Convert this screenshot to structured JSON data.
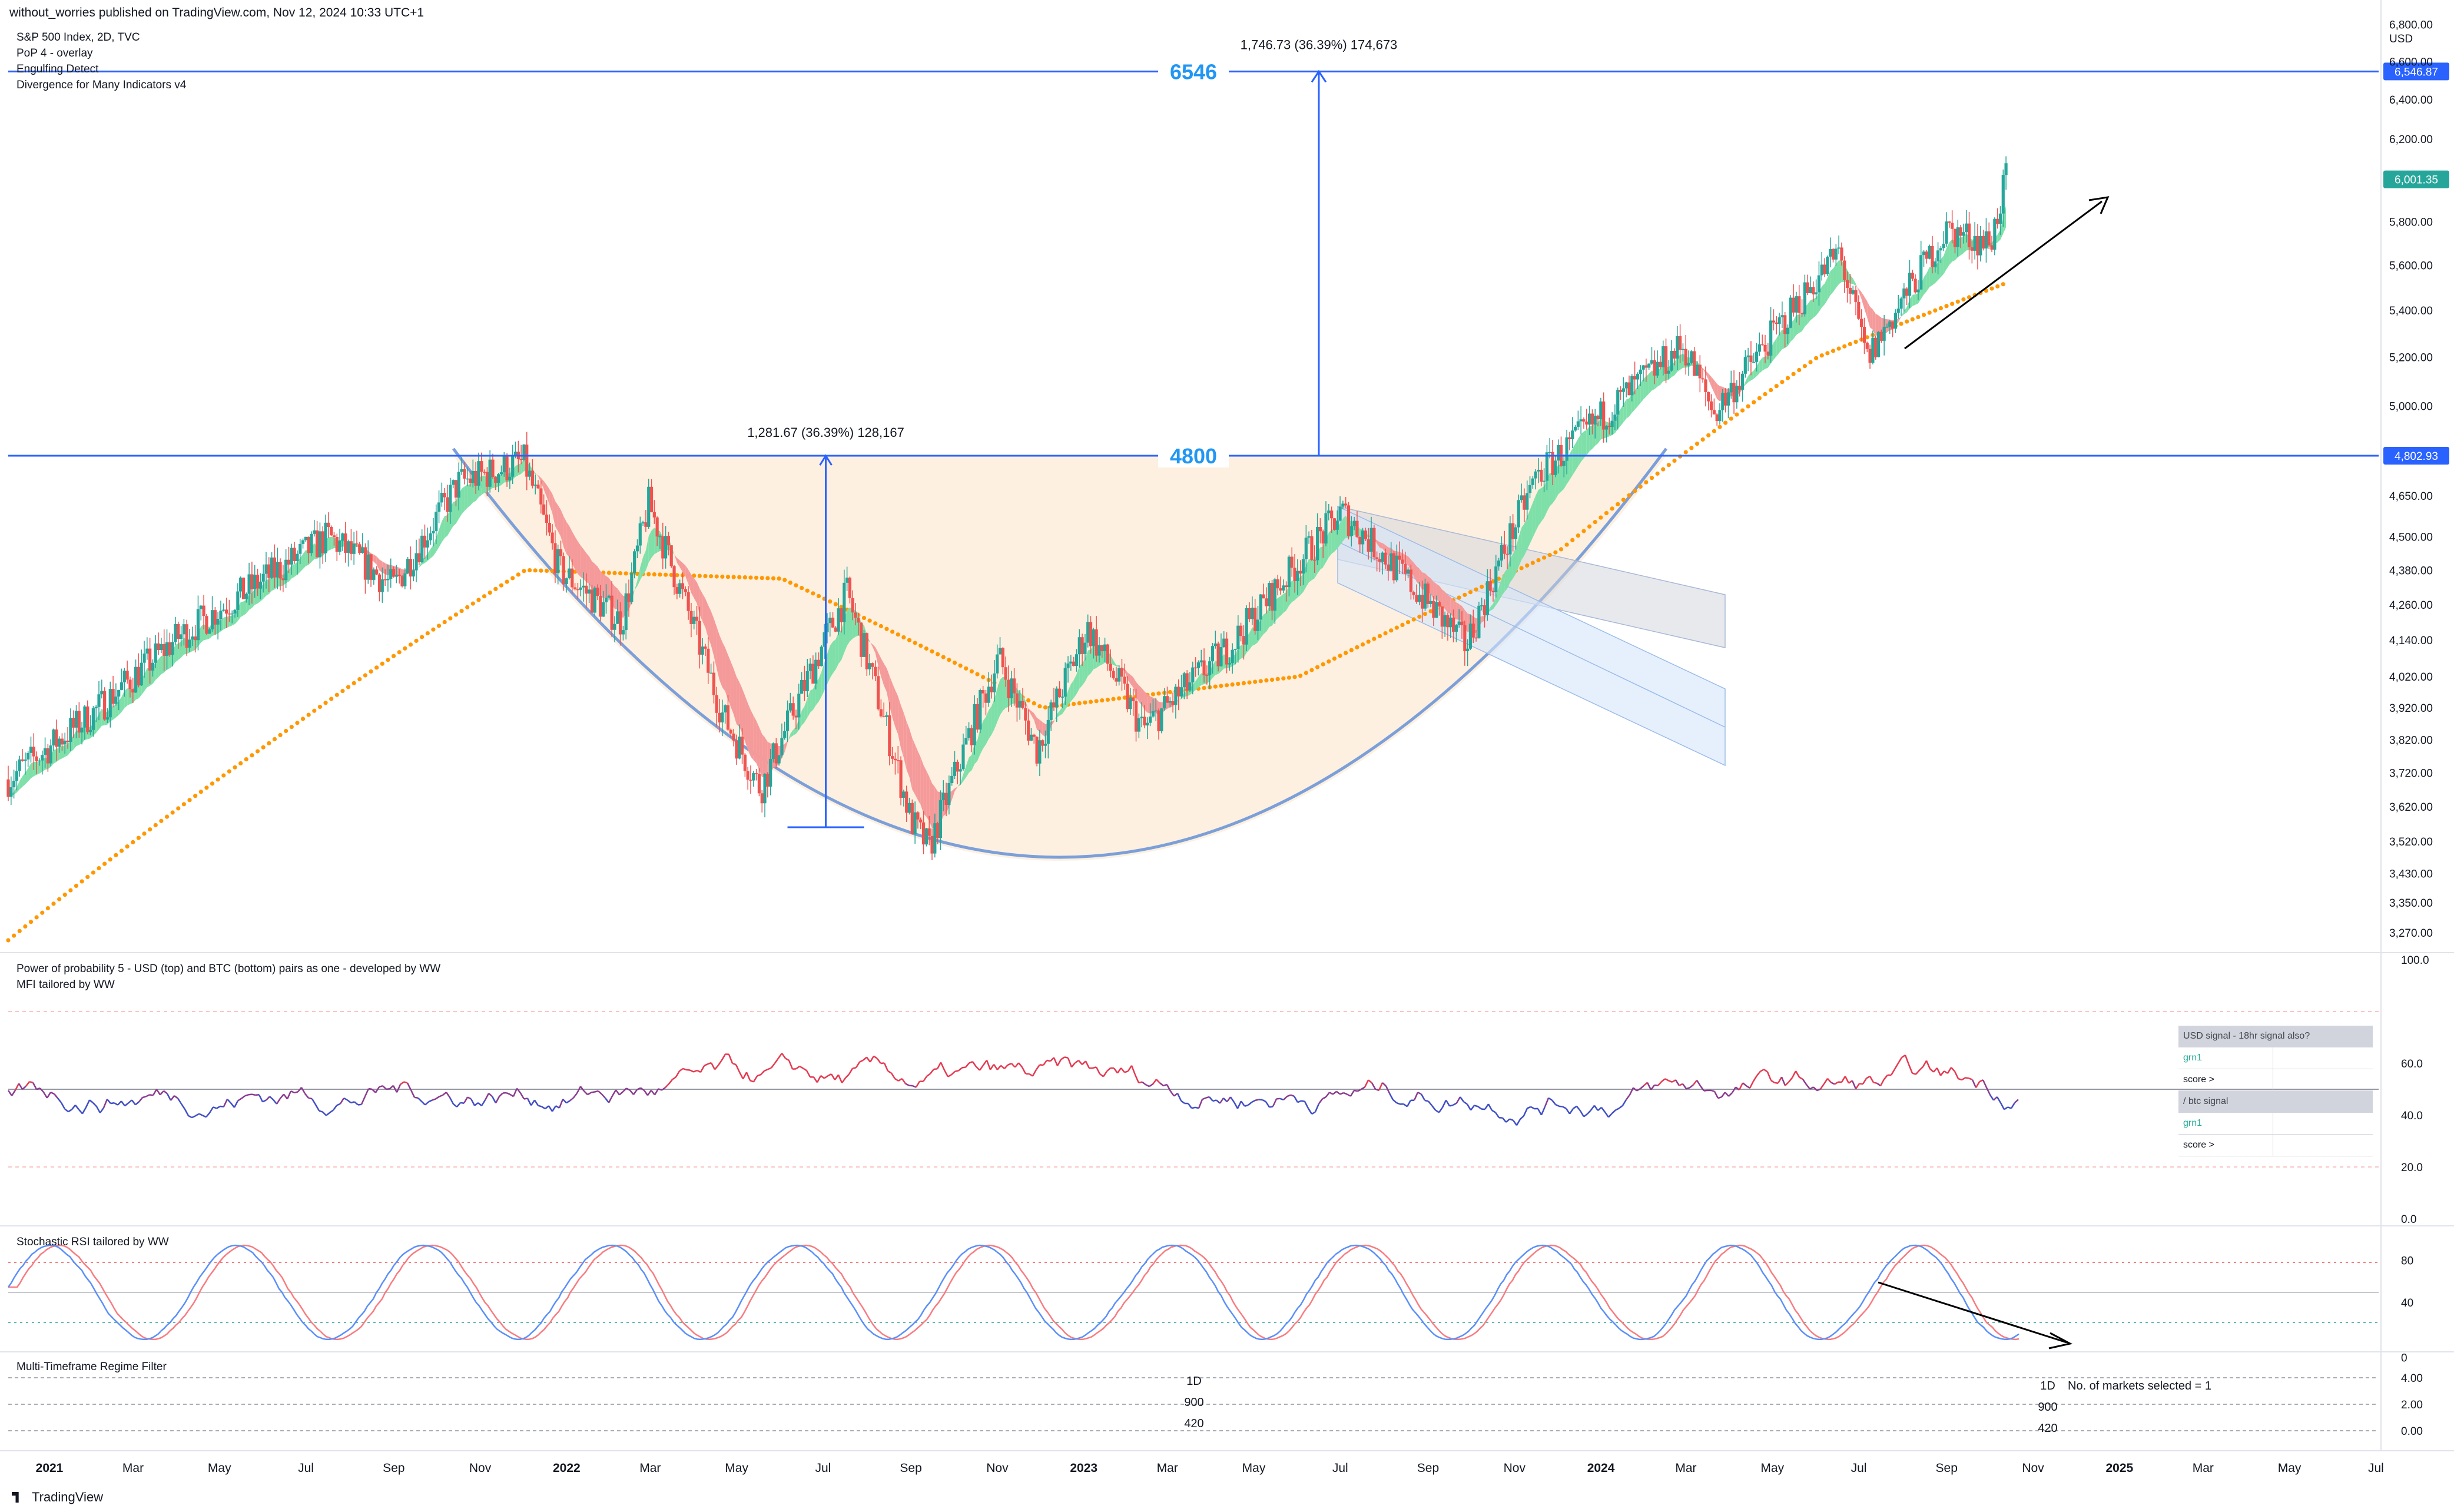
{
  "header": {
    "published": "without_worries published on TradingView.com, Nov 12, 2024 10:33 UTC+1",
    "symbol": "S&P 500 Index, 2D, TVC",
    "indicators": [
      "PoP 4 - overlay",
      "Engulfing Detect",
      "Divergence for Many Indicators v4"
    ],
    "currency": "USD"
  },
  "footer": {
    "brand": "TradingView"
  },
  "colors": {
    "level_line": "#2962ff",
    "ema_ribbon_bull": "#7ee0a8",
    "ema_ribbon_bear": "#f59a9a",
    "sma_dots": "#ff9800",
    "cup_fill": "#fdf0e0",
    "channel_fill": "#d6e6fb",
    "price_badge": "#26a69a"
  },
  "main_panel": {
    "levels": [
      {
        "label": "6546",
        "value": 6546.87,
        "badge": "6,546.87"
      },
      {
        "label": "4800",
        "value": 4802.93,
        "badge": "4,802.93"
      }
    ],
    "last_price_badge": "6,001.35",
    "measures": [
      {
        "text": "1,281.67 (36.39%) 128,167"
      },
      {
        "text": "1,746.73 (36.39%) 174,673"
      }
    ],
    "y_ticks": [
      "6,800.00",
      "6,600.00",
      "6,400.00",
      "6,200.00",
      "5,800.00",
      "5,600.00",
      "5,400.00",
      "5,200.00",
      "5,000.00",
      "4,650.00",
      "4,500.00",
      "4,380.00",
      "4,260.00",
      "4,140.00",
      "4,020.00",
      "3,920.00",
      "3,820.00",
      "3,720.00",
      "3,620.00",
      "3,520.00",
      "3,430.00",
      "3,350.00",
      "3,270.00"
    ]
  },
  "pop_panel": {
    "labels": [
      "Power of probability 5 - USD (top) and BTC (bottom) pairs as one - developed by WW",
      "MFI tailored by WW"
    ],
    "y_ticks": [
      "100.0",
      "60.0",
      "40.0",
      "20.0",
      "0.0"
    ],
    "signal_box": {
      "usd_header": "USD signal - 18hr signal also?",
      "usd_value": "grn1",
      "usd_score": "score >",
      "btc_header": "/ btc signal",
      "btc_value": "grn1",
      "btc_score": "score >"
    }
  },
  "stoch_panel": {
    "label": "Stochastic RSI tailored by WW",
    "y_ticks": [
      "80",
      "40",
      "0"
    ]
  },
  "regime_panel": {
    "label": "Multi-Timeframe Regime Filter",
    "y_ticks": [
      "4.00",
      "2.00",
      "0.00"
    ],
    "left_texts": [
      "1D",
      "900",
      "420"
    ],
    "right_texts": [
      "1D",
      "900",
      "420"
    ],
    "markets_selected": "No. of markets selected = 1"
  },
  "x_axis": {
    "labels": [
      {
        "t": "2021",
        "bold": true
      },
      {
        "t": "Mar"
      },
      {
        "t": "May"
      },
      {
        "t": "Jul"
      },
      {
        "t": "Sep"
      },
      {
        "t": "Nov"
      },
      {
        "t": "2022",
        "bold": true
      },
      {
        "t": "Mar"
      },
      {
        "t": "May"
      },
      {
        "t": "Jul"
      },
      {
        "t": "Sep"
      },
      {
        "t": "Nov"
      },
      {
        "t": "2023",
        "bold": true
      },
      {
        "t": "Mar"
      },
      {
        "t": "May"
      },
      {
        "t": "Jul"
      },
      {
        "t": "Sep"
      },
      {
        "t": "Nov"
      },
      {
        "t": "2024",
        "bold": true
      },
      {
        "t": "Mar"
      },
      {
        "t": "May"
      },
      {
        "t": "Jul"
      },
      {
        "t": "Sep"
      },
      {
        "t": "Nov"
      },
      {
        "t": "2025",
        "bold": true
      },
      {
        "t": "Mar"
      },
      {
        "t": "May"
      },
      {
        "t": "Jul"
      }
    ]
  },
  "chart_data": {
    "type": "line",
    "y_scale": "log",
    "ylim": [
      3230,
      6850
    ],
    "x_range": [
      "2021-01-01",
      "2025-08-01"
    ],
    "price_path": [
      {
        "d": "2021-01-01",
        "v": 3700
      },
      {
        "d": "2021-03-01",
        "v": 3900
      },
      {
        "d": "2021-05-01",
        "v": 4150
      },
      {
        "d": "2021-07-01",
        "v": 4350
      },
      {
        "d": "2021-08-15",
        "v": 4500
      },
      {
        "d": "2021-09-30",
        "v": 4320
      },
      {
        "d": "2021-11-15",
        "v": 4700
      },
      {
        "d": "2021-12-31",
        "v": 4780
      },
      {
        "d": "2022-01-25",
        "v": 4380
      },
      {
        "d": "2022-03-10",
        "v": 4200
      },
      {
        "d": "2022-03-29",
        "v": 4620
      },
      {
        "d": "2022-05-20",
        "v": 3900
      },
      {
        "d": "2022-06-16",
        "v": 3670
      },
      {
        "d": "2022-08-16",
        "v": 4300
      },
      {
        "d": "2022-09-30",
        "v": 3580
      },
      {
        "d": "2022-10-13",
        "v": 3500
      },
      {
        "d": "2022-12-01",
        "v": 4080
      },
      {
        "d": "2022-12-28",
        "v": 3790
      },
      {
        "d": "2023-02-02",
        "v": 4180
      },
      {
        "d": "2023-03-13",
        "v": 3850
      },
      {
        "d": "2023-05-15",
        "v": 4130
      },
      {
        "d": "2023-07-31",
        "v": 4590
      },
      {
        "d": "2023-10-27",
        "v": 4120
      },
      {
        "d": "2023-12-15",
        "v": 4720
      },
      {
        "d": "2024-03-28",
        "v": 5250
      },
      {
        "d": "2024-04-19",
        "v": 4970
      },
      {
        "d": "2024-07-16",
        "v": 5660
      },
      {
        "d": "2024-08-05",
        "v": 5190
      },
      {
        "d": "2024-09-30",
        "v": 5760
      },
      {
        "d": "2024-10-31",
        "v": 5700
      },
      {
        "d": "2024-11-11",
        "v": 6001
      }
    ],
    "sma200_path": [
      {
        "d": "2021-01-01",
        "v": 3250
      },
      {
        "d": "2021-07-01",
        "v": 3800
      },
      {
        "d": "2022-01-01",
        "v": 4380
      },
      {
        "d": "2022-07-01",
        "v": 4350
      },
      {
        "d": "2023-01-01",
        "v": 3920
      },
      {
        "d": "2023-07-01",
        "v": 4020
      },
      {
        "d": "2024-01-01",
        "v": 4450
      },
      {
        "d": "2024-07-01",
        "v": 5200
      },
      {
        "d": "2024-11-11",
        "v": 5520
      }
    ],
    "annotations": [
      {
        "type": "hline",
        "value": 6546.87
      },
      {
        "type": "hline",
        "value": 4802.93
      },
      {
        "type": "measure",
        "from_date": "2022-08-01",
        "from": 3560,
        "to": 4802.93
      },
      {
        "type": "measure",
        "from_date": "2023-07-15",
        "from": 4802.93,
        "to": 6546.87
      }
    ]
  }
}
